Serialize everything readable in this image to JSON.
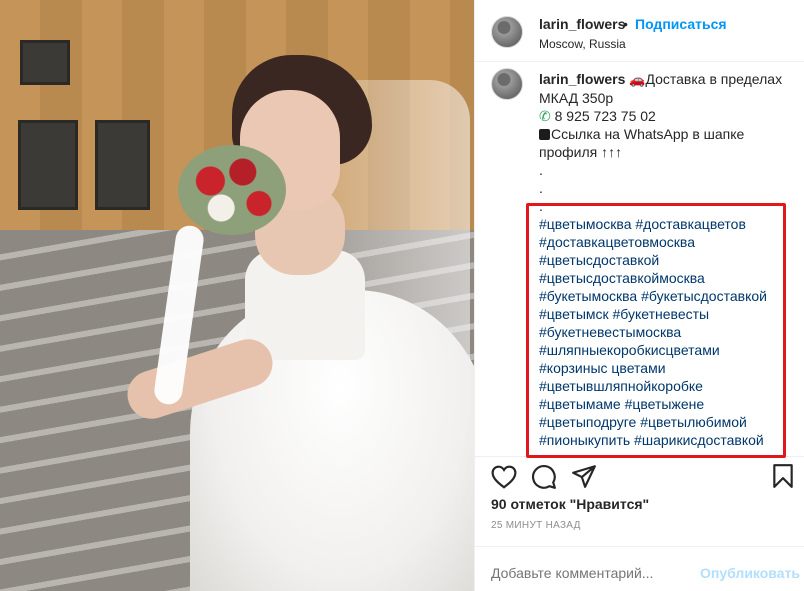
{
  "header": {
    "username": "larin_flowers",
    "dot": "•",
    "follow_label": "Подписаться",
    "location": "Moscow, Russia"
  },
  "caption": {
    "username": "larin_flowers",
    "line1": "Доставка в пределах",
    "line2": "МКАД 350р",
    "phone": "8 925 723 75 02",
    "line4": "Ссылка на WhatsApp в шапке",
    "line5": "профиля ↑↑↑",
    "dot1": ".",
    "dot2": ".",
    "dot3": ".",
    "hashtags": [
      "#цветымосква #доставкацветов",
      "#доставкацветовмосква",
      "#цветысдоставкой",
      "#цветысдоставкоймосква",
      "#букетымосква #букетысдоставкой",
      "#цветымск #букетневесты",
      "#букетневестымосква",
      "#шляпныекоробкисцветами",
      "#корзиныс цветами",
      "#цветывшляпнойкоробке",
      "#цветымаме #цветыжене",
      "#цветыподруге #цветылюбимой",
      "#пионыкупить #шарикисдоставкой"
    ]
  },
  "actions": {
    "like_icon": "heart-icon",
    "comment_icon": "comment-icon",
    "share_icon": "share-icon",
    "save_icon": "bookmark-icon"
  },
  "likes_text": "90 отметок \"Нравится\"",
  "time_text": "25 МИНУТ НАЗАД",
  "comment": {
    "placeholder": "Добавьте комментарий...",
    "post_label": "Опубликовать"
  },
  "colors": {
    "link_blue": "#0095f6",
    "hashtag": "#00376b",
    "highlight_red": "#e0181c",
    "post_disabled": "#b2dffc"
  }
}
